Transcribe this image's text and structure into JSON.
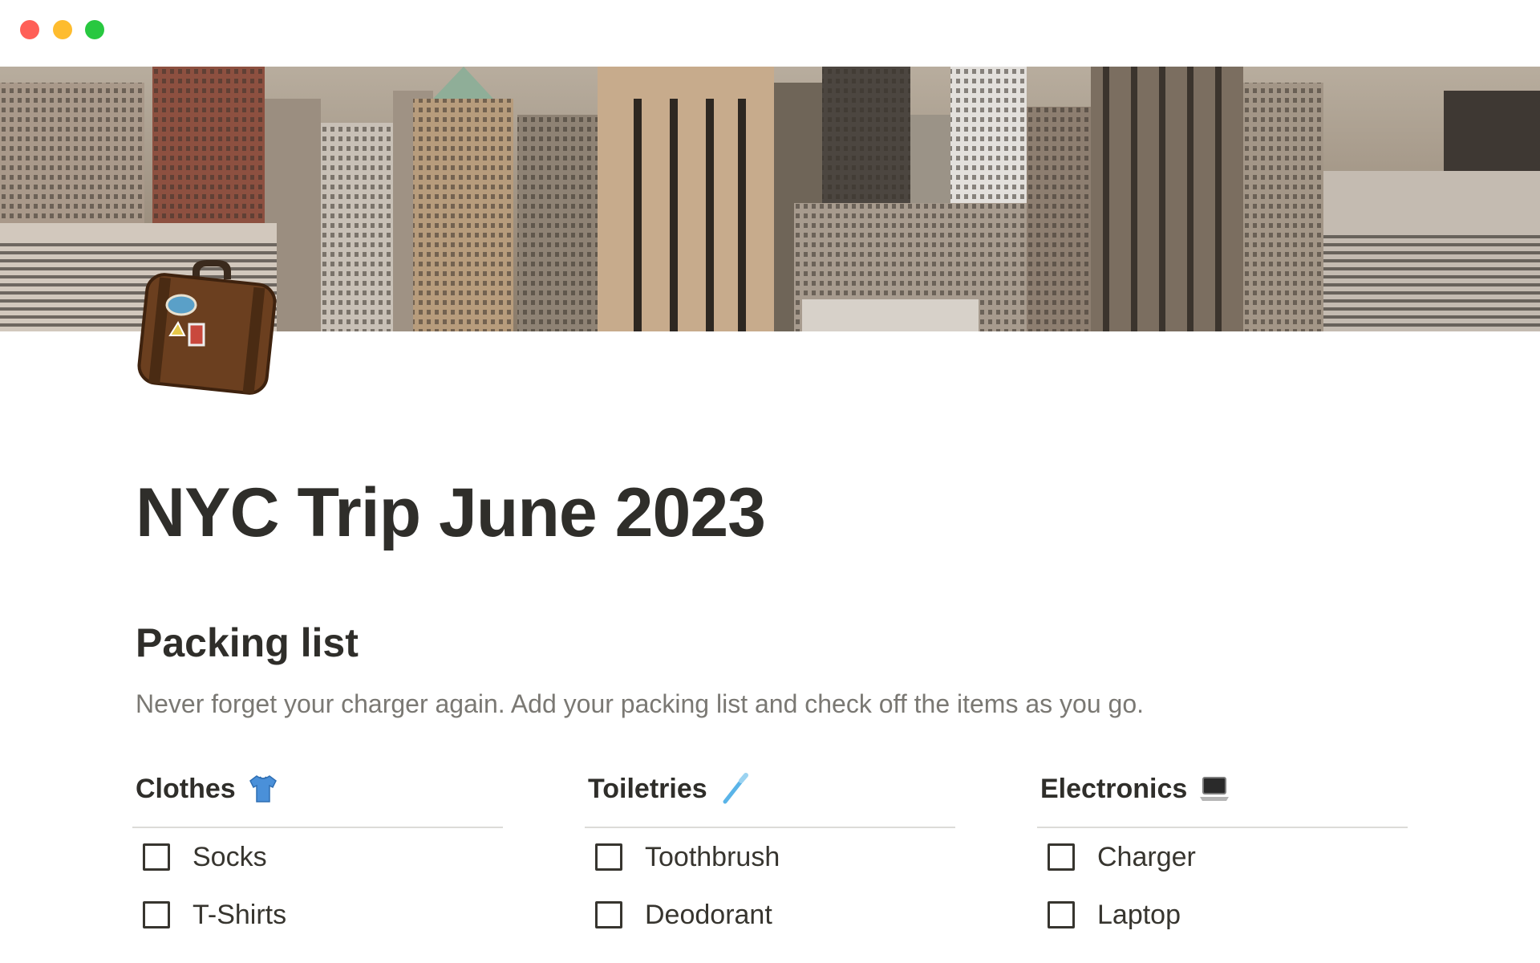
{
  "window": {
    "controls": {
      "close_color": "#ff5f57",
      "minimize_color": "#febc2e",
      "maximize_color": "#28c840"
    }
  },
  "cover": {
    "description_icon": "nyc-skyline-image"
  },
  "page_icon": "suitcase-icon",
  "page": {
    "title": "NYC Trip June 2023",
    "section_title": "Packing list",
    "description": "Never forget your charger again. Add your packing list and check off the items as you go."
  },
  "columns": [
    {
      "heading": "Clothes",
      "icon": "tshirt-icon",
      "items": [
        {
          "label": "Socks",
          "checked": false
        },
        {
          "label": "T-Shirts",
          "checked": false
        }
      ]
    },
    {
      "heading": "Toiletries",
      "icon": "toothbrush-icon",
      "items": [
        {
          "label": "Toothbrush",
          "checked": false
        },
        {
          "label": "Deodorant",
          "checked": false
        }
      ]
    },
    {
      "heading": "Electronics",
      "icon": "laptop-icon",
      "items": [
        {
          "label": "Charger",
          "checked": false
        },
        {
          "label": "Laptop",
          "checked": false
        }
      ]
    }
  ]
}
